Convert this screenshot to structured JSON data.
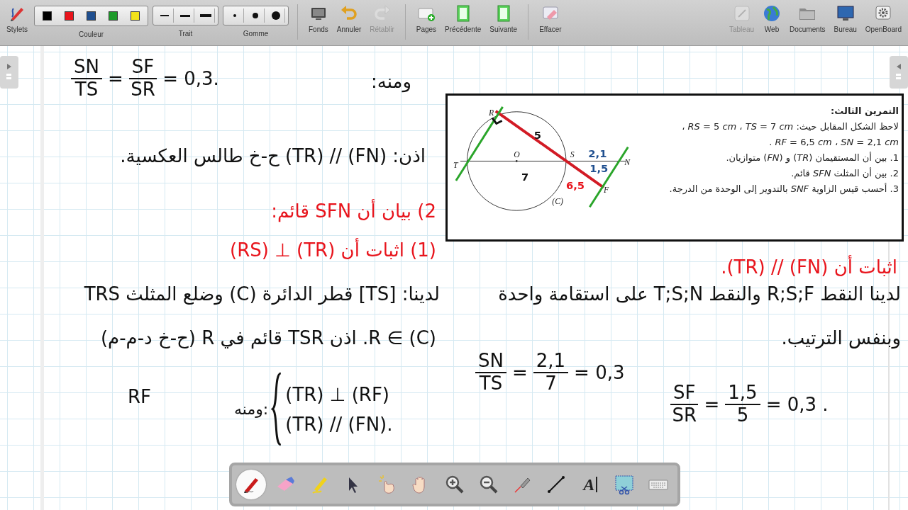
{
  "toolbar": {
    "left": {
      "stylets": {
        "kind": "button",
        "label": "Stylets",
        "disabled": false
      },
      "color_palette": {
        "kind": "swatches",
        "label": "Couleur",
        "colors": [
          {
            "color": "#000000"
          },
          {
            "color": "#e8141c"
          },
          {
            "color": "#1f4f8f"
          },
          {
            "color": "#1e9a2a"
          },
          {
            "color": "#f2e21a"
          }
        ]
      },
      "line_width": {
        "kind": "sizes",
        "label": "Trait"
      },
      "eraser_size": {
        "kind": "dots",
        "label": "Gomme"
      },
      "backgrounds": {
        "kind": "button",
        "label": "Fonds",
        "disabled": false
      },
      "undo": {
        "kind": "button",
        "label": "Annuler",
        "disabled": false
      },
      "redo": {
        "kind": "button",
        "label": "Rétablir",
        "disabled": true
      },
      "pages": {
        "kind": "button",
        "label": "Pages",
        "disabled": false
      },
      "previous": {
        "kind": "button",
        "label": "Précédente",
        "disabled": false
      },
      "next": {
        "kind": "button",
        "label": "Suivante",
        "disabled": false
      },
      "clear": {
        "kind": "button",
        "label": "Effacer",
        "disabled": false
      }
    },
    "right": {
      "board": {
        "label": "Tableau",
        "disabled": true
      },
      "web": {
        "label": "Web",
        "disabled": false
      },
      "documents": {
        "label": "Documents",
        "disabled": false
      },
      "desktop": {
        "label": "Bureau",
        "disabled": false
      },
      "app": {
        "label": "OpenBoard",
        "disabled": false
      }
    }
  },
  "exercise": {
    "title": "التمرين الثالث:",
    "lines": [
      "لاحظ الشكل المقابل حيث: *RS* = 5 *cm* ، *TS* = 7 *cm* ،",
      "*RF* = 6,5 *cm* ، *SN* = 2,1 *cm* .",
      "1. بين أن المستقيمان (*TR*) و (*FN*) متوازيان.",
      "2. بين أن المثلث *SFN* قائم.",
      "3. أحسب قيس الزاوية *SNF* بالتدوير إلى الوحدة من الدرجة."
    ],
    "figure": {
      "points": [
        "R",
        "O",
        "S",
        "T",
        "N",
        "F",
        "(C)"
      ],
      "marks": [
        {
          "text": "5",
          "color": "#111111"
        },
        {
          "text": "7",
          "color": "#111111"
        },
        {
          "text": "2,1",
          "color": "#1f4f8f"
        },
        {
          "text": "1,5",
          "color": "#1f4f8f"
        },
        {
          "text": "6,5",
          "color": "#e8141c"
        }
      ]
    }
  },
  "notes": [
    {
      "kind": "text",
      "color": "#111111",
      "text": "ومنه:"
    },
    {
      "kind": "equation",
      "color": "#111111",
      "left": {
        "num": "SN",
        "den": "TS"
      },
      "equals": "=",
      "right": {
        "num": "SF",
        "den": "SR"
      },
      "result": "= 0,3."
    },
    {
      "kind": "text",
      "color": "#111111",
      "text": "اذن: (FN) // (TR) ح-خ طالس العكسية."
    },
    {
      "kind": "text",
      "color": "#e8141c",
      "text": "2) بيان أن SFN قائم:"
    },
    {
      "kind": "text",
      "color": "#e8141c",
      "text": "اثبات أن (FN) // (TR)."
    },
    {
      "kind": "text",
      "color": "#e8141c",
      "text": "(1) اثبات أن (TR) ⊥ (RS)"
    },
    {
      "kind": "text",
      "color": "#111111",
      "text": "لدينا النقط R;S;F والنقط T;S;N على استقامة واحدة"
    },
    {
      "kind": "text",
      "color": "#111111",
      "text": "لدينا: [TS] قطر الدائرة (C) وضلع المثلث TRS"
    },
    {
      "kind": "text",
      "color": "#111111",
      "text": "وبنفس الترتيب."
    },
    {
      "kind": "text",
      "color": "#111111",
      "text": "R ∈ (C). اذن TSR قائم في R (ح-خ د-م-م)"
    },
    {
      "kind": "equation",
      "color": "#111111",
      "left": {
        "num": "SF",
        "den": "SR"
      },
      "equals": "=",
      "right": {
        "num": "1,5",
        "den": "5"
      },
      "result": "= 0,3 ."
    },
    {
      "kind": "equation",
      "color": "#111111",
      "left": {
        "num": "SN",
        "den": "TS"
      },
      "equals": "=",
      "right": {
        "num": "2,1",
        "den": "7"
      },
      "result": "= 0,3"
    },
    {
      "kind": "system",
      "color": "#111111",
      "label": "ومنه:",
      "lines": [
        "(TR) ⊥ (RF)",
        "(TR) // (FN)."
      ]
    },
    {
      "kind": "text",
      "color": "#111111",
      "text": "RF"
    }
  ],
  "tools": [
    {
      "selected": true
    },
    {
      "selected": false
    },
    {
      "selected": false
    },
    {
      "selected": false
    },
    {
      "selected": false
    },
    {
      "selected": false
    },
    {
      "selected": false
    },
    {
      "selected": false
    },
    {
      "selected": false
    },
    {
      "selected": false
    },
    {
      "selected": false,
      "glyph": "A"
    },
    {
      "selected": false
    },
    {
      "selected": false
    }
  ]
}
